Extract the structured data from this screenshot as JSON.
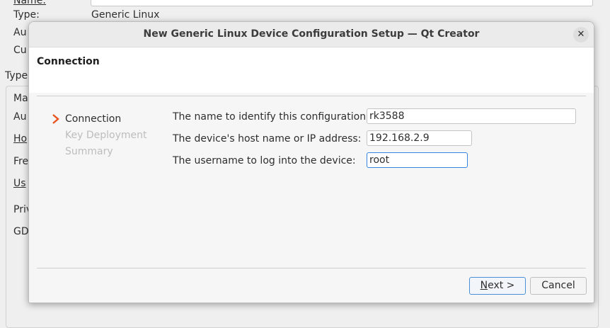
{
  "background_window": {
    "labels": [
      "Name:",
      "Type:",
      "Au",
      "Cu",
      "Type",
      "Ma",
      "Au",
      "Ho",
      "Fre",
      "Us",
      "Priv",
      "GD"
    ],
    "type_value": "Generic Linux"
  },
  "dialog": {
    "title": "New Generic Linux Device Configuration Setup — Qt Creator",
    "close_glyph": "✕",
    "page_title": "Connection",
    "steps": [
      {
        "label": "Connection",
        "state": "current"
      },
      {
        "label": "Key Deployment",
        "state": "future"
      },
      {
        "label": "Summary",
        "state": "future"
      }
    ],
    "form": {
      "config_name_label": "The name to identify this configuration:",
      "config_name_value": "rk3588",
      "host_label": "The device's host name or IP address:",
      "host_value": "192.168.2.9",
      "user_label": "The username to log into the device:",
      "user_value": "root"
    },
    "buttons": {
      "next_mnemonic": "N",
      "next_rest": "ext >",
      "cancel": "Cancel"
    }
  },
  "colors": {
    "accent": "#3584e4",
    "step_arrow": "#e95420",
    "disabled_text": "#bdbdbd"
  }
}
